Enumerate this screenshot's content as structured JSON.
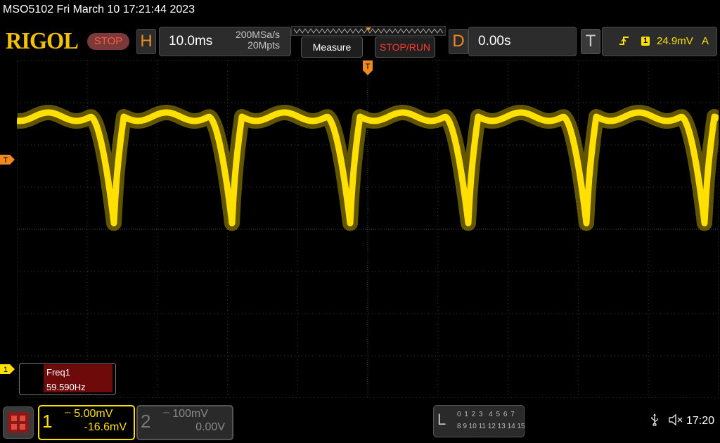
{
  "title_bar": "MSO5102  Fri March 10 17:21:44 2023",
  "brand": "RIGOL",
  "run_state": "STOP",
  "horizontal": {
    "key": "H",
    "time_scale": "10.0ms",
    "sample_rate": "200MSa/s",
    "memory_depth": "20Mpts"
  },
  "buttons": {
    "measure": "Measure",
    "stop_run": "STOP/RUN"
  },
  "delay": {
    "key": "D",
    "value": "0.00s"
  },
  "trigger": {
    "key": "T",
    "source": "1",
    "level": "24.9mV",
    "mode": "A",
    "marker": "T"
  },
  "markers": {
    "trigger_position": "T",
    "channel1": "1"
  },
  "measurement": {
    "name": "Freq1",
    "value": "59.590Hz"
  },
  "channel1": {
    "number": "1",
    "scale": "5.00mV",
    "offset": "-16.6mV",
    "color": "#ffe000"
  },
  "channel2": {
    "number": "2",
    "scale": "100mV",
    "offset": "0.00V"
  },
  "logic_analyzer": {
    "key": "L",
    "row1": "0 1 2 3  4 5 6 7",
    "row2": "8 9 10 11 12 13 14 15"
  },
  "status": {
    "time": "17:20",
    "usb_icon": "usb-icon",
    "mute_icon": "speaker-muted-icon"
  },
  "colors": {
    "accent": "#f08a1c",
    "trace": "#ffe000",
    "stop": "#ff3b30",
    "measure_bg": "#6e0a0a"
  }
}
